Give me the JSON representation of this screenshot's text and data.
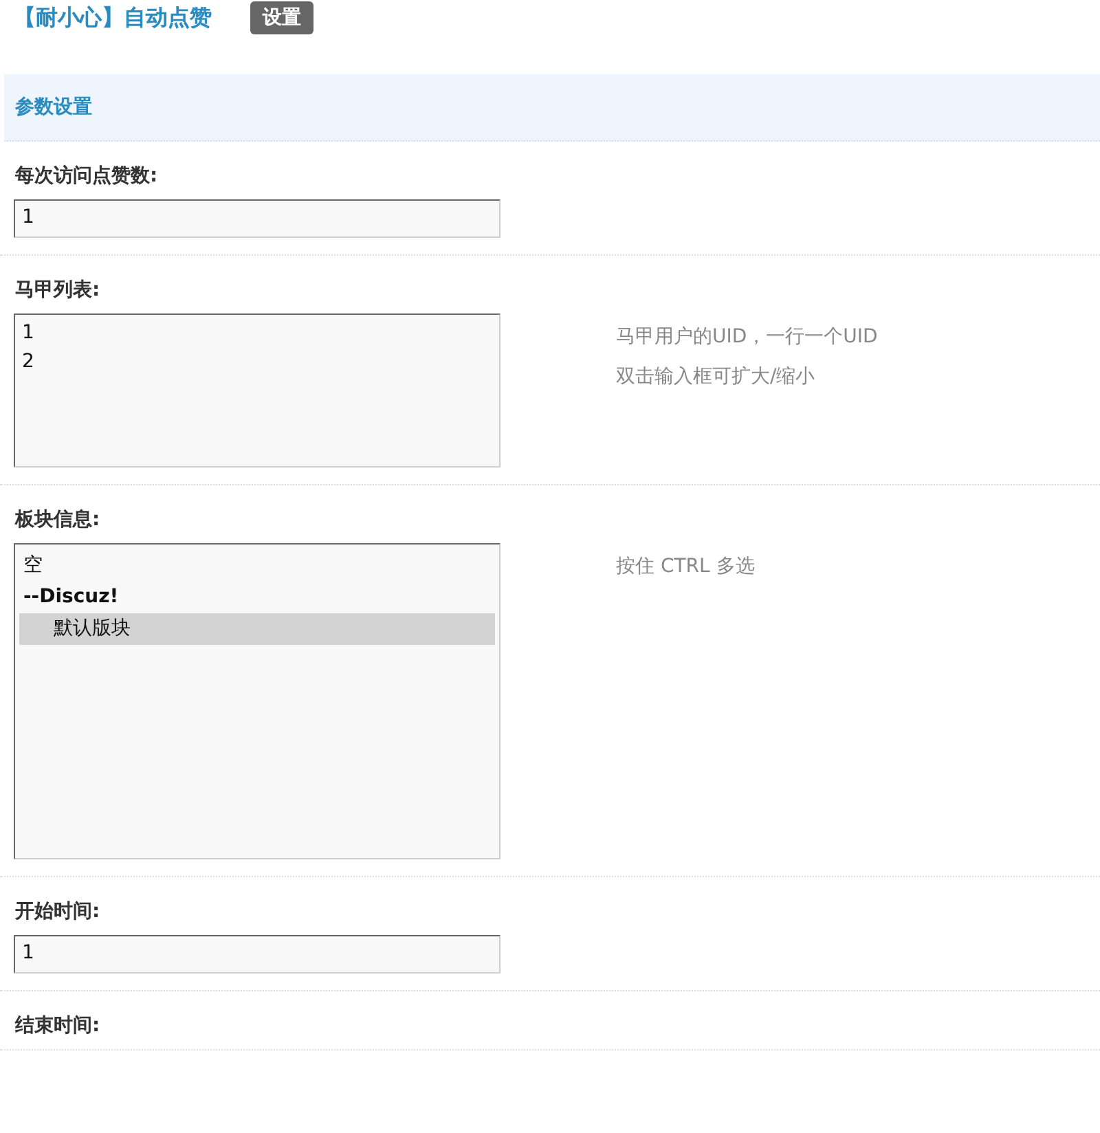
{
  "header": {
    "title": "【耐小心】自动点赞",
    "tabs": [
      {
        "label": "设置",
        "selected": true
      }
    ]
  },
  "section": {
    "title": "参数设置"
  },
  "settings": [
    {
      "label": "每次访问点赞数:",
      "kind": "text",
      "value": "1"
    },
    {
      "label": "马甲列表:",
      "kind": "textarea",
      "lines": [
        "1",
        "2"
      ],
      "hints": [
        "马甲用户的UID，一行一个UID",
        "双击输入框可扩大/缩小"
      ]
    },
    {
      "label": "板块信息:",
      "kind": "select",
      "options": [
        {
          "label": "空",
          "selected": false
        },
        {
          "label": "--Discuz!",
          "selected": false,
          "children": [
            {
              "label": "默认版块",
              "selected": true
            }
          ]
        }
      ],
      "hints": [
        "按住 CTRL 多选"
      ]
    },
    {
      "label": "开始时间:",
      "kind": "text",
      "value": "1"
    },
    {
      "label": "结束时间:",
      "kind": "label"
    }
  ]
}
